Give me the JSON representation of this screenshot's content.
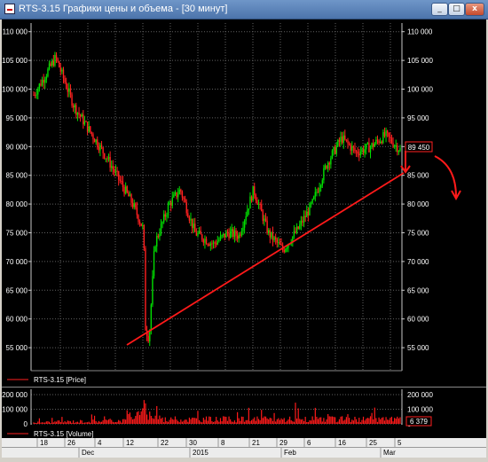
{
  "window": {
    "title": "RTS-3.15 Графики цены и объема - [30 минут]",
    "controls": {
      "minimize": "_",
      "maximize": "□",
      "close": "x"
    }
  },
  "colors": {
    "up": "#00dd00",
    "down": "#ff2020",
    "trendline": "#ff1a1a",
    "grid": "#606060",
    "background": "#000000"
  },
  "price_panel": {
    "left_axis_labels": [
      "110 000",
      "105 000",
      "100 000",
      "95 000",
      "90 000",
      "85 000",
      "80 000",
      "75 000",
      "70 000",
      "65 000",
      "60 000",
      "55 000"
    ],
    "right_axis_labels": [
      "110 000",
      "105 000",
      "100 000",
      "95 000",
      "90 000",
      "85 000",
      "80 000",
      "75 000",
      "70 000",
      "65 000",
      "60 000",
      "55 000"
    ],
    "last_price_label": "89 450",
    "legend": "RTS-3.15 [Price]"
  },
  "volume_panel": {
    "left_axis_labels": [
      "200 000",
      "100 000",
      "0"
    ],
    "right_axis_labels": [
      "200 000",
      "100 000",
      "0"
    ],
    "last_volume_label": "6 379",
    "legend": "RTS-3.15 [Volume]"
  },
  "time_axis": {
    "days": [
      "18",
      "26",
      "4",
      "12",
      "22",
      "30",
      "8",
      "21",
      "29",
      "6",
      "16",
      "25",
      "5"
    ],
    "months": [
      "Dec",
      "2015",
      "Feb",
      "Mar"
    ]
  },
  "chart_data": {
    "type": "line",
    "title": "RTS-3.15 Графики цены и объема - [30 минут]",
    "x": [
      "18",
      "26",
      "Dec",
      "4",
      "12",
      "22",
      "30",
      "2015",
      "8",
      "21",
      "29",
      "Feb",
      "6",
      "16",
      "25",
      "Mar",
      "5"
    ],
    "series": [
      {
        "name": "RTS-3.15 [Price]",
        "values": [
          99000,
          105500,
          91000,
          84000,
          76500,
          80000,
          73000,
          77000,
          76500,
          81500,
          72500,
          81500,
          89000,
          92000,
          90000,
          91500,
          89450
        ]
      },
      {
        "name": "RTS-3.15 [Volume]",
        "values": [
          12000,
          15000,
          18000,
          25000,
          110000,
          60000,
          45000,
          30000,
          40000,
          45000,
          50000,
          55000,
          60000,
          65000,
          60000,
          55000,
          6379
        ]
      }
    ],
    "price_range_visible": [
      55000,
      106000
    ],
    "ylim": [
      51000,
      111500
    ],
    "volume_ylim": [
      0,
      230000
    ],
    "trendline": {
      "from_price": 55000,
      "to_price": 84000
    },
    "grid": true
  }
}
